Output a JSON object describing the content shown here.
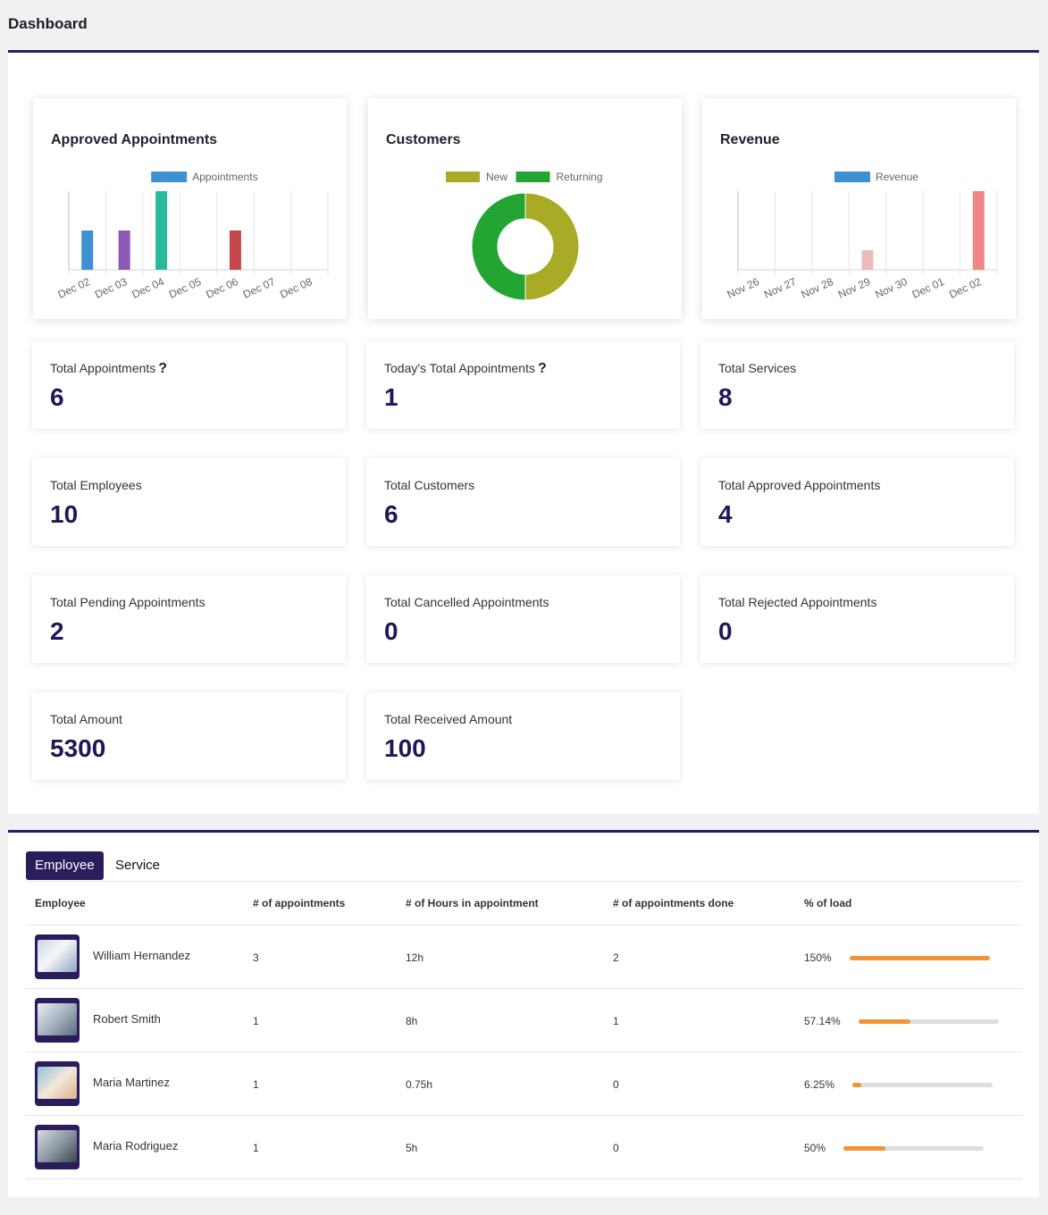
{
  "page": {
    "title": "Dashboard"
  },
  "charts": [
    {
      "title": "Approved Appointments",
      "chart_data": {
        "type": "bar",
        "legend": [
          "Appointments"
        ],
        "legend_color": "#3f90d1",
        "categories": [
          "Dec 02",
          "Dec 03",
          "Dec 04",
          "Dec 05",
          "Dec 06",
          "Dec 07",
          "Dec 08"
        ],
        "values": [
          1,
          1,
          2,
          0,
          1,
          0,
          0
        ],
        "bar_colors": [
          "#3f90d1",
          "#8e58b5",
          "#2cb89d",
          "#3f90d1",
          "#c6474a",
          "#3f90d1",
          "#3f90d1"
        ],
        "ylim": [
          0,
          2
        ],
        "grid": true
      }
    },
    {
      "title": "Customers",
      "chart_data": {
        "type": "pie",
        "labels": [
          "New",
          "Returning"
        ],
        "values": [
          50,
          50
        ],
        "colors": [
          "#a9ab27",
          "#23a534"
        ]
      }
    },
    {
      "title": "Revenue",
      "chart_data": {
        "type": "bar",
        "legend": [
          "Revenue"
        ],
        "legend_color": "#3f90d1",
        "categories": [
          "Nov 26",
          "Nov 27",
          "Nov 28",
          "Nov 29",
          "Nov 30",
          "Dec 01",
          "Dec 02"
        ],
        "values": [
          0,
          0,
          0,
          20,
          0,
          0,
          80
        ],
        "bar_colors": [
          "#3f90d1",
          "#3f90d1",
          "#3f90d1",
          "#ecbcbc",
          "#3f90d1",
          "#3f90d1",
          "#ef8688"
        ],
        "ylim": [
          0,
          80
        ],
        "grid": true
      }
    }
  ],
  "stats": [
    {
      "label": "Total Appointments",
      "value": "6",
      "help": "?"
    },
    {
      "label": "Today's Total Appointments",
      "value": "1",
      "help": "?"
    },
    {
      "label": "Total Services",
      "value": "8"
    },
    {
      "label": "Total Employees",
      "value": "10"
    },
    {
      "label": "Total Customers",
      "value": "6"
    },
    {
      "label": "Total Approved Appointments",
      "value": "4"
    },
    {
      "label": "Total Pending Appointments",
      "value": "2"
    },
    {
      "label": "Total Cancelled Appointments",
      "value": "0"
    },
    {
      "label": "Total Rejected Appointments",
      "value": "0"
    },
    {
      "label": "Total Amount",
      "value": "5300"
    },
    {
      "label": "Total Received Amount",
      "value": "100"
    }
  ],
  "tabs": {
    "employee": "Employee",
    "service": "Service"
  },
  "table": {
    "headers": [
      "Employee",
      "# of appointments",
      "# of Hours in appointment",
      "# of appointments done",
      "% of load"
    ],
    "rows": [
      {
        "name": "William Hernandez",
        "appointments": "3",
        "hours": "12h",
        "done": "2",
        "load": "150%",
        "load_fraction": 1.0
      },
      {
        "name": "Robert Smith",
        "appointments": "1",
        "hours": "8h",
        "done": "1",
        "load": "57.14%",
        "load_fraction": 0.3714
      },
      {
        "name": "Maria Martinez",
        "appointments": "1",
        "hours": "0.75h",
        "done": "0",
        "load": "6.25%",
        "load_fraction": 0.0625
      },
      {
        "name": "Maria Rodriguez",
        "appointments": "1",
        "hours": "5h",
        "done": "0",
        "load": "50%",
        "load_fraction": 0.3
      }
    ]
  },
  "colors": {
    "accent": "#2b1d5c",
    "value_text": "#221656",
    "load_bar": "#f0943a"
  }
}
